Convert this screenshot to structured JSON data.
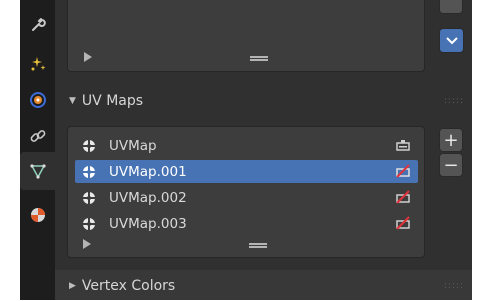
{
  "sections": {
    "uv_maps": {
      "title": "UV Maps",
      "collapse_icon": "chevron-down-icon"
    },
    "vertex_colors": {
      "title": "Vertex Colors",
      "collapse_icon": "chevron-right-icon"
    }
  },
  "uv_maps": [
    {
      "name": "UVMap",
      "active_render": true,
      "selected": false
    },
    {
      "name": "UVMap.001",
      "active_render": false,
      "selected": true
    },
    {
      "name": "UVMap.002",
      "active_render": false,
      "selected": false
    },
    {
      "name": "UVMap.003",
      "active_render": false,
      "selected": false
    }
  ],
  "list_buttons": {
    "add": "+",
    "remove": "−"
  },
  "tabs": [
    "wrench-icon",
    "particles-icon",
    "physics-icon",
    "constraints-icon",
    "mesh-data-icon",
    "material-icon"
  ],
  "colors": {
    "selection": "#4772b3",
    "panel_bg": "#303030",
    "list_bg": "#3d3d3d",
    "tab_strip": "#1d1d1d",
    "camera_disabled": "#e0323c"
  }
}
